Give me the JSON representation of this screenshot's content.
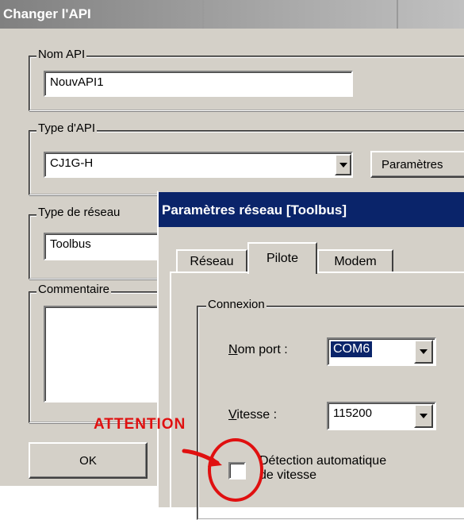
{
  "main_dialog": {
    "title": "Changer l'API",
    "nom_api": {
      "label": "Nom API",
      "value": "NouvAPI1"
    },
    "type_api": {
      "label": "Type d'API",
      "value": "CJ1G-H",
      "button": "Paramètres"
    },
    "type_reseau": {
      "label": "Type de réseau",
      "value": "Toolbus"
    },
    "commentaire": {
      "label": "Commentaire",
      "value": ""
    },
    "ok_label": "OK"
  },
  "network_dialog": {
    "title": "Paramètres réseau [Toolbus]",
    "tabs": [
      {
        "label": "Réseau",
        "active": false
      },
      {
        "label": "Pilote",
        "active": true
      },
      {
        "label": "Modem",
        "active": false
      }
    ],
    "connexion": {
      "label": "Connexion",
      "nom_port": {
        "label": "Nom port :",
        "value": "COM6"
      },
      "vitesse": {
        "label": "Vitesse :",
        "value": "115200"
      },
      "auto_detect": {
        "label_line1": "Détection automatique",
        "label_line2": "de vitesse",
        "checked": false
      }
    }
  },
  "annotation": {
    "text": "ATTENTION",
    "color": "#e01010"
  },
  "colors": {
    "dialog_bg": "#d4d0c8",
    "title_active": "#0a246a",
    "title_inactive": "#808080",
    "highlight": "#0a246a"
  }
}
